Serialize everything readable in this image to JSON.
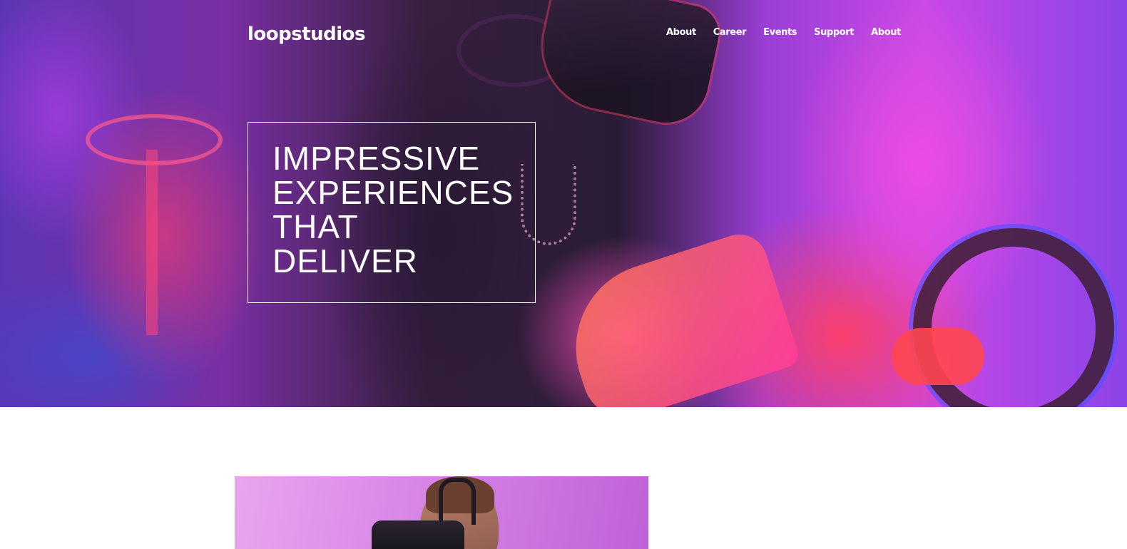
{
  "brand": {
    "logo_text": "loopstudios"
  },
  "nav": {
    "items": [
      {
        "label": "About"
      },
      {
        "label": "Career"
      },
      {
        "label": "Events"
      },
      {
        "label": "Support"
      },
      {
        "label": "About"
      }
    ]
  },
  "hero": {
    "headline_lines": [
      "IMPRESSIVE",
      "EXPERIENCES",
      "THAT",
      "DELIVER"
    ]
  },
  "colors": {
    "text_on_hero": "#ffffff",
    "page_background": "#ffffff",
    "accent_magenta": "#c848e6"
  },
  "icons": {
    "hero_image": "vr-gamer-photo",
    "feature_image": "vr-headset-person-photo"
  }
}
